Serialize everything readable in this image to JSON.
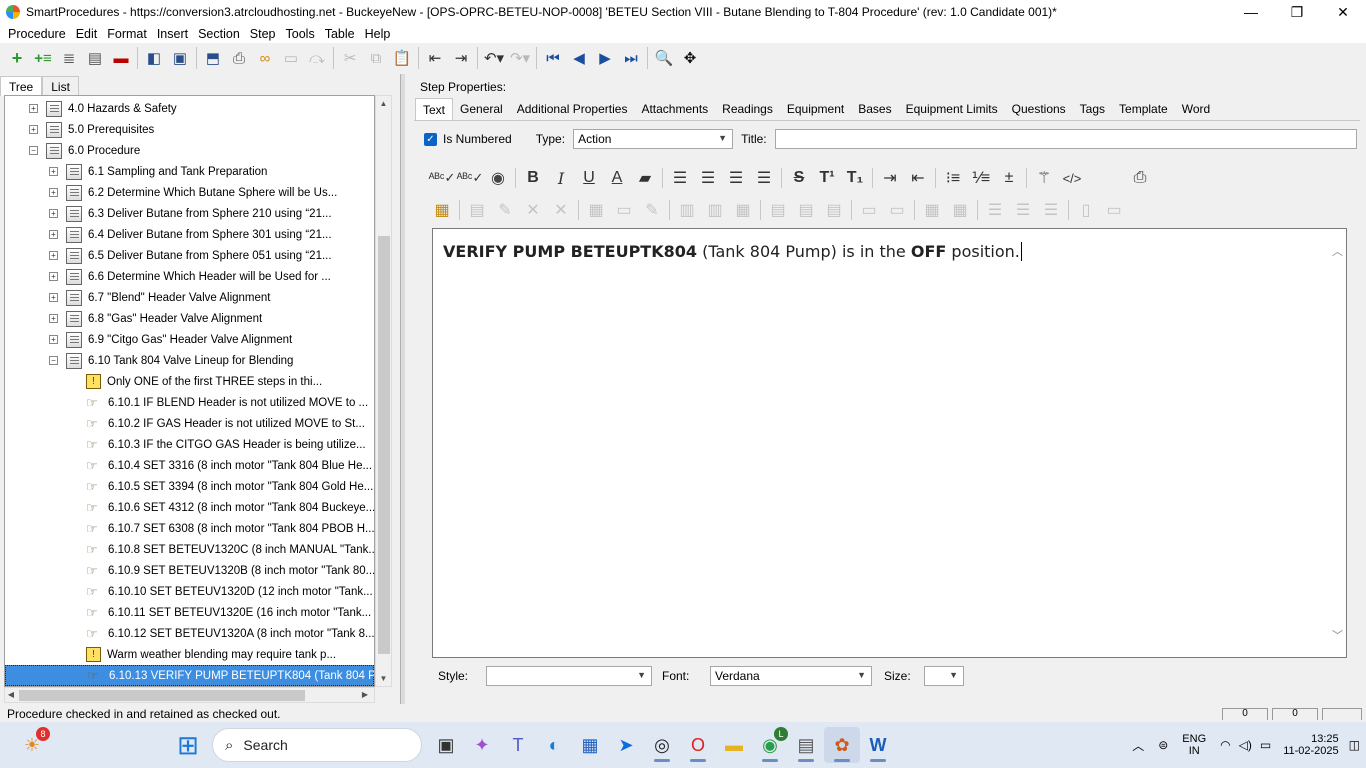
{
  "window": {
    "title": "SmartProcedures - https://conversion3.atrcloudhosting.net - BuckeyeNew - [OPS-OPRC-BETEU-NOP-0008] 'BETEU Section VIII - Butane Blending to T-804 Procedure' (rev: 1.0 Candidate 001)*",
    "minimize": "—",
    "restore": "❐",
    "close": "✕"
  },
  "menu": [
    "Procedure",
    "Edit",
    "Format",
    "Insert",
    "Section",
    "Step",
    "Tools",
    "Table",
    "Help"
  ],
  "left_tabs": [
    "Tree",
    "List"
  ],
  "tree": [
    {
      "label": "4.0 Hazards & Safety",
      "level": 1,
      "exp": "+",
      "icon": "doc"
    },
    {
      "label": "5.0 Prerequisites",
      "level": 1,
      "exp": "+",
      "icon": "doc"
    },
    {
      "label": "6.0 Procedure",
      "level": 1,
      "exp": "−",
      "icon": "doc"
    },
    {
      "label": "6.1 Sampling and Tank Preparation",
      "level": 2,
      "exp": "+",
      "icon": "doc"
    },
    {
      "label": "6.2 Determine Which Butane Sphere will be Us...",
      "level": 2,
      "exp": "+",
      "icon": "doc"
    },
    {
      "label": "6.3 Deliver Butane from Sphere 210 using “21...",
      "level": 2,
      "exp": "+",
      "icon": "doc"
    },
    {
      "label": "6.4 Deliver Butane from Sphere 301 using “21...",
      "level": 2,
      "exp": "+",
      "icon": "doc"
    },
    {
      "label": "6.5 Deliver Butane from Sphere 051 using “21...",
      "level": 2,
      "exp": "+",
      "icon": "doc"
    },
    {
      "label": "6.6 Determine Which Header will be Used for ...",
      "level": 2,
      "exp": "+",
      "icon": "doc"
    },
    {
      "label": "6.7 \"Blend\" Header Valve Alignment",
      "level": 2,
      "exp": "+",
      "icon": "doc"
    },
    {
      "label": "6.8 \"Gas\" Header Valve Alignment",
      "level": 2,
      "exp": "+",
      "icon": "doc"
    },
    {
      "label": "6.9 \"Citgo Gas\" Header Valve Alignment",
      "level": 2,
      "exp": "+",
      "icon": "doc"
    },
    {
      "label": "6.10 Tank 804 Valve Lineup for Blending",
      "level": 2,
      "exp": "−",
      "icon": "doc"
    },
    {
      "label": "Only ONE of the first THREE steps in thi...",
      "level": 3,
      "exp": "",
      "icon": "warn"
    },
    {
      "label": "6.10.1 IF BLEND Header is not utilized MOVE to ...",
      "level": 3,
      "exp": "",
      "icon": "step"
    },
    {
      "label": "6.10.2 IF GAS Header is not utilized MOVE to St...",
      "level": 3,
      "exp": "",
      "icon": "step"
    },
    {
      "label": "6.10.3 IF the CITGO GAS Header is being utilize...",
      "level": 3,
      "exp": "",
      "icon": "step"
    },
    {
      "label": "6.10.4 SET 3316 (8 inch motor \"Tank 804 Blue He...",
      "level": 3,
      "exp": "",
      "icon": "step"
    },
    {
      "label": "6.10.5 SET 3394 (8 inch motor \"Tank 804 Gold He...",
      "level": 3,
      "exp": "",
      "icon": "step"
    },
    {
      "label": "6.10.6 SET 4312 (8 inch motor \"Tank 804 Buckeye...",
      "level": 3,
      "exp": "",
      "icon": "step"
    },
    {
      "label": "6.10.7 SET 6308 (8 inch motor \"Tank 804 PBOB H...",
      "level": 3,
      "exp": "",
      "icon": "step"
    },
    {
      "label": "6.10.8 SET BETEUV1320C (8 inch MANUAL \"Tank...",
      "level": 3,
      "exp": "",
      "icon": "step"
    },
    {
      "label": "6.10.9 SET BETEUV1320B (8 inch motor \"Tank 80...",
      "level": 3,
      "exp": "",
      "icon": "step"
    },
    {
      "label": "6.10.10 SET BETEUV1320D (12 inch motor \"Tank...",
      "level": 3,
      "exp": "",
      "icon": "step"
    },
    {
      "label": "6.10.11 SET BETEUV1320E (16 inch motor \"Tank...",
      "level": 3,
      "exp": "",
      "icon": "step"
    },
    {
      "label": "6.10.12 SET BETEUV1320A (8 inch motor \"Tank 8...",
      "level": 3,
      "exp": "",
      "icon": "step"
    },
    {
      "label": "Warm weather blending may require tank p...",
      "level": 3,
      "exp": "",
      "icon": "warn"
    },
    {
      "label": "6.10.13 VERIFY PUMP BETEUPTK804 (Tank 804 P...",
      "level": 3,
      "exp": "",
      "icon": "step",
      "selected": true
    }
  ],
  "status": {
    "text": "Procedure checked in and retained as checked out.",
    "panel1": "0",
    "panel2": "0"
  },
  "properties": {
    "label": "Step Properties:",
    "tabs": [
      "Text",
      "General",
      "Additional Properties",
      "Attachments",
      "Readings",
      "Equipment",
      "Bases",
      "Equipment Limits",
      "Questions",
      "Tags",
      "Template",
      "Word"
    ],
    "is_numbered_label": "Is Numbered",
    "type_label": "Type:",
    "type_value": "Action",
    "title_label": "Title:",
    "title_value": "",
    "editor": {
      "part1": "VERIFY PUMP BETEUPTK804",
      "part2": " (Tank 804 Pump) is in the ",
      "part3": "OFF",
      "part4": " position."
    },
    "style_label": "Style:",
    "style_value": "",
    "font_label": "Font:",
    "font_value": "Verdana",
    "size_label": "Size:",
    "size_value": ""
  },
  "taskbar": {
    "search_placeholder": "Search",
    "notif_count": "8",
    "lang1": "ENG",
    "lang2": "IN",
    "time": "13:25",
    "date": "11-02-2025",
    "chrome_badge": "L"
  }
}
